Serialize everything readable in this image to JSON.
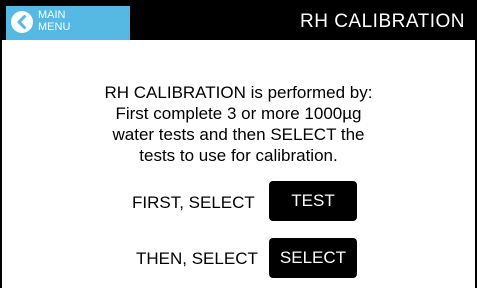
{
  "header": {
    "main_menu_label": "MAIN\nMENU",
    "title": "RH CALIBRATION"
  },
  "body": {
    "description": "RH CALIBRATION is performed by:\nFirst complete 3 or more 1000µg\nwater tests and then SELECT the\ntests to use for calibration.",
    "first_label": "FIRST, SELECT",
    "test_button": "TEST",
    "then_label": "THEN, SELECT",
    "select_button": "SELECT"
  },
  "colors": {
    "accent": "#55b9e4",
    "header_bg": "#000000",
    "button_bg": "#000000"
  },
  "icons": {
    "main_menu": "back-arrow-circle-icon"
  }
}
